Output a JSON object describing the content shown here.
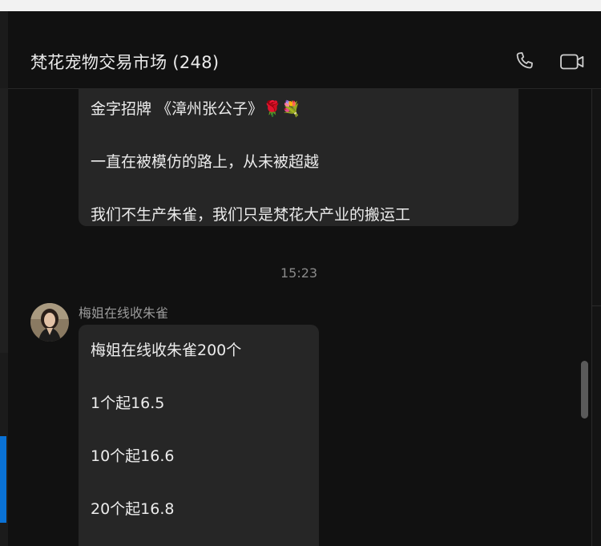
{
  "header": {
    "title": "梵花宠物交易市场 (248)",
    "phone_icon": "phone-icon",
    "video_icon": "video-call-icon"
  },
  "messages": {
    "first": {
      "lines": [
        "金字招牌 《漳州张公子》🌹💐",
        "一直在被模仿的路上，从未被超越",
        "我们不生产朱雀，我们只是梵花大产业的搬运工"
      ]
    },
    "timestamp": "15:23",
    "second": {
      "sender": "梅姐在线收朱雀",
      "lines": [
        "梅姐在线收朱雀200个",
        "1个起16.5",
        "10个起16.6",
        "20个起16.8"
      ]
    }
  },
  "colors": {
    "background": "#111111",
    "bubble": "#262626",
    "accent": "#0a72d6"
  }
}
